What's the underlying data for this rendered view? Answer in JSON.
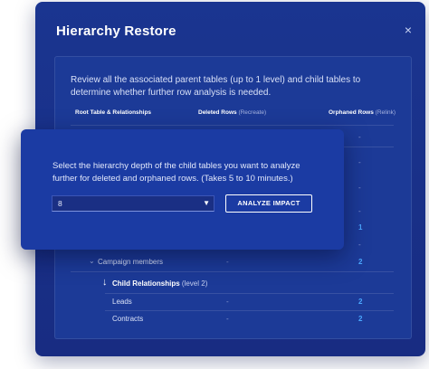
{
  "dialog": {
    "title": "Hierarchy Restore",
    "close_icon": "×",
    "description": "Review all the associated parent tables (up to 1 level) and child tables to determine whether further row analysis is needed.",
    "columns": {
      "root": "Root Table & Relationships",
      "deleted": "Deleted Rows",
      "deleted_sub": "(Recreate)",
      "orphaned": "Orphaned Rows",
      "orphaned_sub": "(Relink)"
    },
    "rows": [
      {
        "label": "",
        "deleted": "",
        "orphaned": "-"
      },
      {
        "label": "",
        "deleted": "",
        "orphaned": "-"
      },
      {
        "label": "",
        "deleted": "",
        "orphaned": "-"
      },
      {
        "label": "",
        "deleted": "",
        "orphaned": "-"
      },
      {
        "label": "",
        "deleted": "",
        "orphaned": "1"
      },
      {
        "label": "",
        "deleted": "",
        "orphaned": "-"
      },
      {
        "label": "Campaign members",
        "deleted": "-",
        "orphaned": "2"
      }
    ],
    "child_relationships": {
      "label": "Child Relationships",
      "level": "(level 2)"
    },
    "child_rows": [
      {
        "label": "Leads",
        "deleted": "-",
        "orphaned": "2"
      },
      {
        "label": "Contracts",
        "deleted": "-",
        "orphaned": "2"
      }
    ]
  },
  "popup": {
    "text": "Select the hierarchy depth of the child tables you want to analyze further for deleted and orphaned rows. (Takes 5 to 10 minutes.)",
    "depth_value": "8",
    "button_label": "ANALYZE IMPACT"
  },
  "icons": {
    "chevron": "⌄",
    "down_arrow": "↓",
    "caret": "▼"
  },
  "colors": {
    "dialog_bg": "#1a3590",
    "popup_bg": "#1b3ba3",
    "link": "#4aa8ff"
  }
}
